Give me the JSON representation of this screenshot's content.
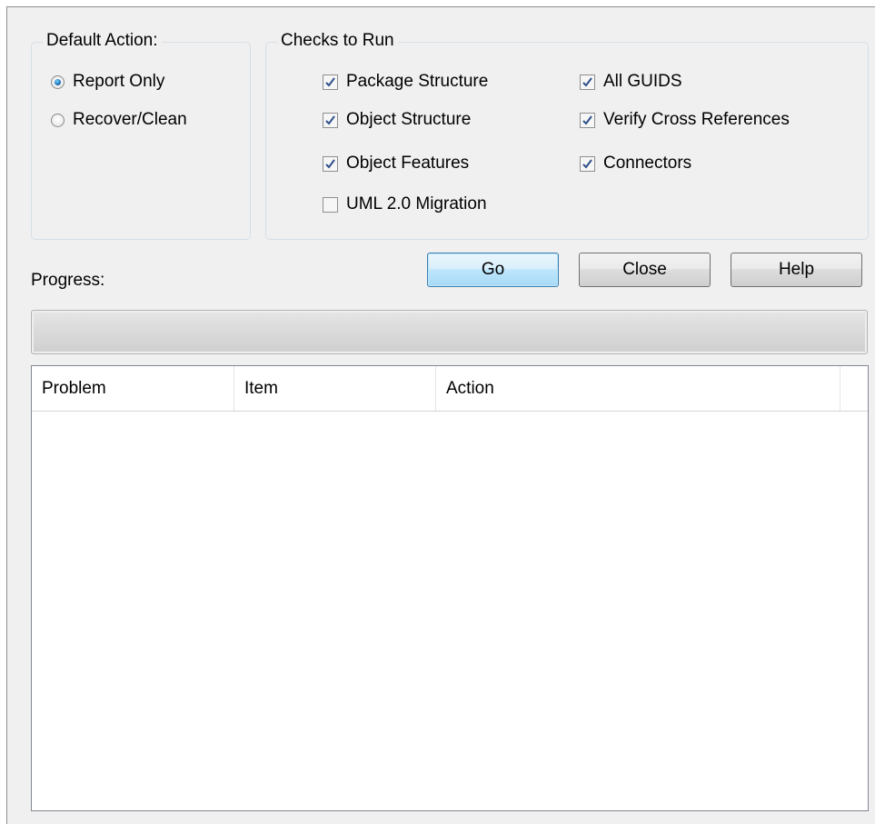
{
  "default_action": {
    "title": "Default Action:",
    "options": [
      "Report Only",
      "Recover/Clean"
    ],
    "selected": "Report Only"
  },
  "checks": {
    "title": "Checks to Run",
    "items": [
      {
        "label": "Package Structure",
        "checked": true
      },
      {
        "label": "Object Structure",
        "checked": true
      },
      {
        "label": "Object Features",
        "checked": true
      },
      {
        "label": "UML 2.0 Migration",
        "checked": false
      },
      {
        "label": "All GUIDS",
        "checked": true
      },
      {
        "label": "Verify Cross References",
        "checked": true
      },
      {
        "label": "Connectors",
        "checked": true
      }
    ]
  },
  "progress": {
    "label": "Progress:",
    "value": 0
  },
  "buttons": {
    "go": "Go",
    "close": "Close",
    "help": "Help"
  },
  "results": {
    "columns": [
      "Problem",
      "Item",
      "Action"
    ],
    "rows": []
  }
}
